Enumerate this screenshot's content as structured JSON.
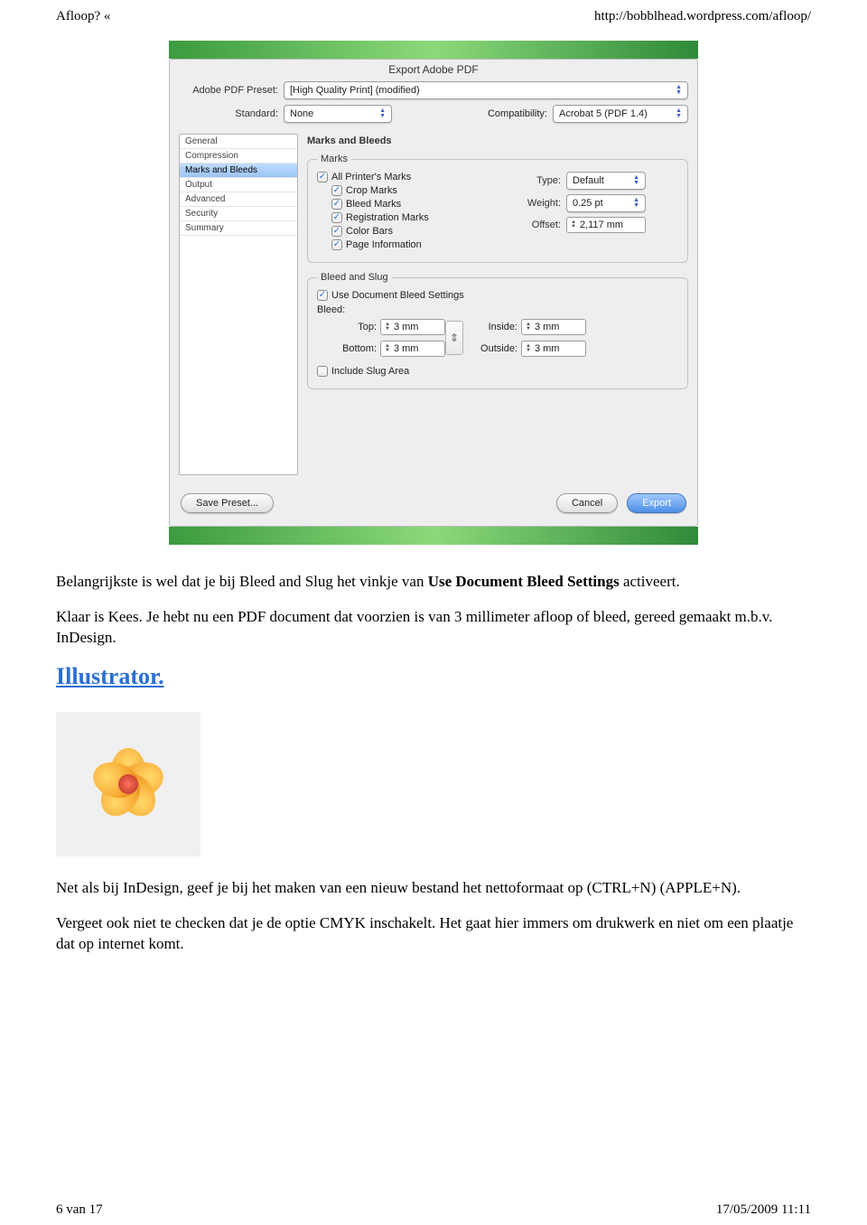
{
  "header": {
    "left": "Afloop? «",
    "right": "http://bobblhead.wordpress.com/afloop/"
  },
  "dialog": {
    "title": "Export Adobe PDF",
    "preset_label": "Adobe PDF Preset:",
    "preset_value": "[High Quality Print] (modified)",
    "standard_label": "Standard:",
    "standard_value": "None",
    "compat_label": "Compatibility:",
    "compat_value": "Acrobat 5 (PDF 1.4)",
    "sidebar": [
      "General",
      "Compression",
      "Marks and Bleeds",
      "Output",
      "Advanced",
      "Security",
      "Summary"
    ],
    "panel_title": "Marks and Bleeds",
    "marks": {
      "legend": "Marks",
      "all_printers": "All Printer's Marks",
      "crop": "Crop Marks",
      "bleed": "Bleed Marks",
      "registration": "Registration Marks",
      "colorbars": "Color Bars",
      "pageinfo": "Page Information",
      "type_label": "Type:",
      "type_value": "Default",
      "weight_label": "Weight:",
      "weight_value": "0.25 pt",
      "offset_label": "Offset:",
      "offset_value": "2,117 mm"
    },
    "bleedslug": {
      "legend": "Bleed and Slug",
      "use_doc": "Use Document Bleed Settings",
      "bleed_heading": "Bleed:",
      "top_label": "Top:",
      "bottom_label": "Bottom:",
      "inside_label": "Inside:",
      "outside_label": "Outside:",
      "top": "3 mm",
      "bottom": "3 mm",
      "inside": "3 mm",
      "outside": "3 mm",
      "include_slug": "Include Slug Area"
    },
    "buttons": {
      "save_preset": "Save Preset...",
      "cancel": "Cancel",
      "export": "Export"
    }
  },
  "article": {
    "p1a": "Belangrijkste is wel dat je bij Bleed and Slug het vinkje van ",
    "p1b": "Use Document Bleed Settings",
    "p1c": " activeert.",
    "p2": "Klaar is Kees. Je hebt nu een PDF document dat voorzien is van 3 millimeter afloop of bleed, gereed gemaakt m.b.v. InDesign.",
    "heading": "Illustrator.",
    "p3": "Net als bij InDesign, geef je bij het maken van een nieuw bestand het nettoformaat op (CTRL+N) (APPLE+N).",
    "p4": "Vergeet ook niet te checken dat je de optie CMYK inschakelt. Het gaat hier immers om drukwerk en niet om een plaatje dat op internet komt."
  },
  "footer": {
    "left": "6 van 17",
    "right": "17/05/2009 11:11"
  }
}
